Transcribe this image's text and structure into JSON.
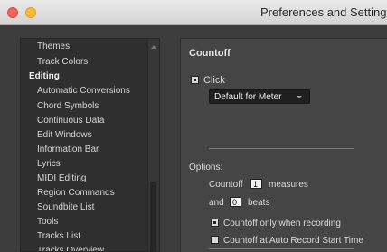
{
  "window": {
    "title": "Preferences and Settings"
  },
  "sidebar": {
    "items": [
      {
        "label": "Themes",
        "header": false
      },
      {
        "label": "Track Colors",
        "header": false
      },
      {
        "label": "Editing",
        "header": true
      },
      {
        "label": "Automatic Conversions",
        "header": false
      },
      {
        "label": "Chord Symbols",
        "header": false
      },
      {
        "label": "Continuous Data",
        "header": false
      },
      {
        "label": "Edit Windows",
        "header": false
      },
      {
        "label": "Information Bar",
        "header": false
      },
      {
        "label": "Lyrics",
        "header": false
      },
      {
        "label": "MIDI Editing",
        "header": false
      },
      {
        "label": "Region Commands",
        "header": false
      },
      {
        "label": "Soundbite List",
        "header": false
      },
      {
        "label": "Tools",
        "header": false
      },
      {
        "label": "Tracks List",
        "header": false
      },
      {
        "label": "Tracks Overview",
        "header": false
      }
    ]
  },
  "panel": {
    "section_title": "Countoff",
    "click_label": "Click",
    "click_checked": true,
    "meter_select": "Default for Meter",
    "options_label": "Options:",
    "countoff_label": "Countoff",
    "measures_value": "1",
    "measures_label": "measures",
    "and_label": "and",
    "beats_value": "0",
    "beats_label": "beats",
    "only_recording_label": "Countoff only when recording",
    "only_recording_checked": true,
    "auto_record_label": "Countoff at Auto Record Start Time",
    "auto_record_checked": false
  }
}
